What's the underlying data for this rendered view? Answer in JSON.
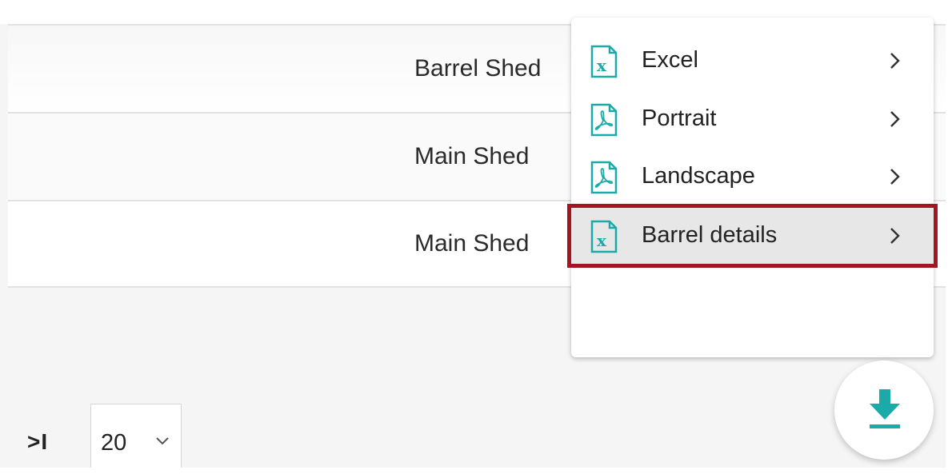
{
  "table": {
    "rows": [
      {
        "location": "Barrel Shed"
      },
      {
        "location": "Main Shed"
      },
      {
        "location": "Main Shed"
      }
    ]
  },
  "pagination": {
    "last_page_symbol": ">I",
    "page_size": "20"
  },
  "export_menu": {
    "items": [
      {
        "label": "Excel",
        "icon": "excel-file-icon"
      },
      {
        "label": "Portrait",
        "icon": "pdf-file-icon"
      },
      {
        "label": "Landscape",
        "icon": "pdf-file-icon"
      },
      {
        "label": "Barrel details",
        "icon": "excel-file-icon"
      }
    ],
    "highlighted_item": "Barrel details"
  },
  "download_button": {
    "icon": "download-icon"
  },
  "colors": {
    "accent": "#1aaba8",
    "highlight_border": "#a31621",
    "highlight_bg": "#e7e7e7"
  }
}
